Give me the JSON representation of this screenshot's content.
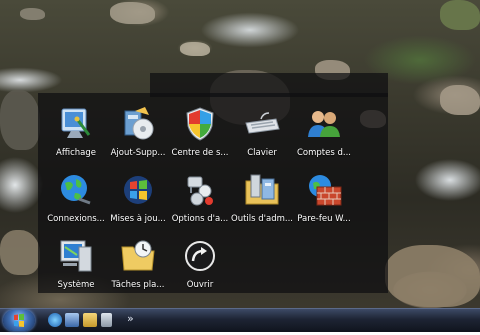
{
  "launcher": {
    "items": [
      {
        "label": "Affichage",
        "icon": "display-icon"
      },
      {
        "label": "Ajout-Supp...",
        "icon": "add-remove-programs-icon"
      },
      {
        "label": "Centre de s...",
        "icon": "security-center-shield-icon"
      },
      {
        "label": "Clavier",
        "icon": "keyboard-icon"
      },
      {
        "label": "Comptes d...",
        "icon": "user-accounts-icon"
      },
      {
        "label": "Connexions...",
        "icon": "network-connections-globe-icon"
      },
      {
        "label": "Mises à jou...",
        "icon": "windows-update-icon"
      },
      {
        "label": "Options d'a...",
        "icon": "accessibility-options-icon"
      },
      {
        "label": "Outils d'adm...",
        "icon": "administrative-tools-icon"
      },
      {
        "label": "Pare-feu W...",
        "icon": "firewall-brick-icon"
      },
      {
        "label": "Système",
        "icon": "system-computer-icon"
      },
      {
        "label": "Tâches pla...",
        "icon": "scheduled-tasks-folder-icon"
      },
      {
        "label": "Ouvrir",
        "icon": "open-arrow-icon"
      }
    ]
  },
  "taskbar": {
    "overflow_glyph": "»",
    "quick_launch": [
      "ie-icon",
      "show-desktop-icon",
      "explorer-folder-icon",
      "media-icon"
    ]
  },
  "colors": {
    "panel": "#0e0e10",
    "taskbar_top": "#3d4a66",
    "taskbar_bottom": "#10141d"
  }
}
